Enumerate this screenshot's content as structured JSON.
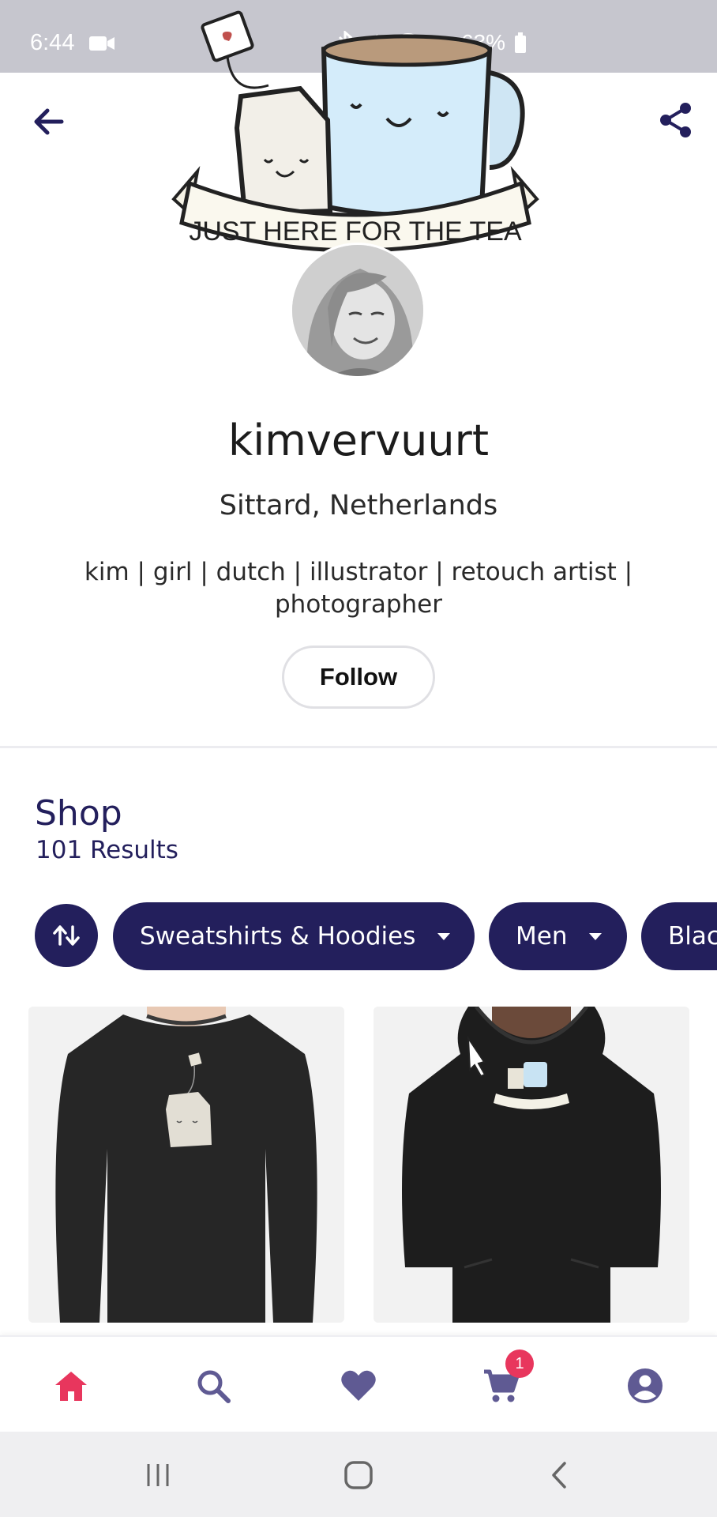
{
  "status_bar": {
    "time": "6:44",
    "battery": "63%"
  },
  "header": {
    "back_icon": "arrow-left-icon",
    "share_icon": "share-icon",
    "banner_text": "JUST HERE FOR THE TEA"
  },
  "profile": {
    "username": "kimvervuurt",
    "location": "Sittard, Netherlands",
    "bio": "kim | girl | dutch | illustrator | retouch artist | photographer",
    "follow_label": "Follow"
  },
  "shop": {
    "title": "Shop",
    "results": "101 Results",
    "sort_icon": "sort-arrows-icon",
    "filters": [
      {
        "label": "Sweatshirts & Hoodies"
      },
      {
        "label": "Men"
      },
      {
        "label": "Blac"
      }
    ]
  },
  "bottom_nav": {
    "items": [
      "home-icon",
      "search-icon",
      "heart-icon",
      "cart-icon",
      "account-icon"
    ],
    "cart_badge": "1",
    "active_color": "#e8365d",
    "inactive_color": "#5f5a93"
  },
  "colors": {
    "accent": "#231f5c",
    "badge": "#e8365d"
  }
}
